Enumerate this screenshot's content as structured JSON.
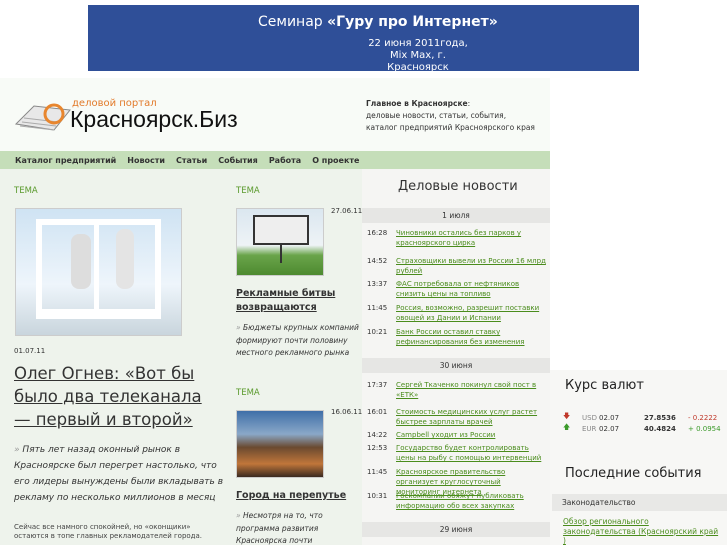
{
  "banner": {
    "line1_pre": "Семинар ",
    "line1_bold": "«Гуру про Интернет»",
    "line2": "22 июня 2011года,",
    "line3": "Mix Max, г. Красноярск"
  },
  "logo": {
    "sub": "деловой портал",
    "main": "Красноярск.Биз"
  },
  "tagline": {
    "bold": "Главное в Красноярске",
    "line1": "деловые новости, статьи, события,",
    "line2": "каталог предприятий Красноярского края"
  },
  "nav": [
    "Каталог предприятий",
    "Новости",
    "Статьи",
    "События",
    "Работа",
    "О проекте"
  ],
  "main_article": {
    "tag": "ТЕМА",
    "date": "01.07.11",
    "title": "Олег Огнев: «Вот бы было два телеканала — первый и второй»",
    "lead": "Пять лет назад оконный рынок в Красноярске был перегрет настолько, что его лидеры вынуждены были вкладывать в рекламу по несколько миллионов в месяц",
    "text": "Сейчас все намного спокойней, но «оконщики» остаются в топе главных рекламодателей города."
  },
  "side_articles": [
    {
      "tag": "ТЕМА",
      "date": "27.06.11",
      "title": "Рекламные битвы возвращаются",
      "lead": "Бюджеты крупных компаний формируют почти половину местного рекламного рынка"
    },
    {
      "tag": "ТЕМА",
      "date": "16.06.11",
      "title": "Город на перепутье",
      "lead": "Несмотря на то, что программа развития Красноярска почти"
    }
  ],
  "news": {
    "title": "Деловые новости",
    "days": [
      {
        "label": "1 июля",
        "items": [
          {
            "time": "16:28",
            "text": "Чиновники остались без парков у красноярского цирка"
          },
          {
            "time": "14:52",
            "text": "Страховщики вывели из России 16 млрд рублей"
          },
          {
            "time": "13:37",
            "text": "ФАС потребовала от нефтяников снизить цены на топливо"
          },
          {
            "time": "11:45",
            "text": "Россия, возможно, разрешит поставки овощей из Дании и Испании"
          },
          {
            "time": "10:21",
            "text": "Банк России оставил ставку рефинансирования без изменения"
          }
        ]
      },
      {
        "label": "30 июня",
        "items": [
          {
            "time": "17:37",
            "text": "Сергей Ткаченко покинул свой пост в «ЕТК»"
          },
          {
            "time": "16:01",
            "text": "Стоимость медицинских услуг растет быстрее зарплаты врачей"
          },
          {
            "time": "14:22",
            "text": "Campbell уходит из России"
          },
          {
            "time": "12:53",
            "text": "Государство будет контролировать цены на рыбу с помощью интервенций"
          },
          {
            "time": "11:45",
            "text": "Красноярское правительство организует круглосуточный мониторинг интернета"
          },
          {
            "time": "10:31",
            "text": "Госкомпании обяжут публиковать информацию обо всех закупках"
          }
        ]
      },
      {
        "label": "29 июня",
        "items": []
      }
    ]
  },
  "rates": {
    "title": "Курс валют",
    "rows": [
      {
        "cur": "USD",
        "date": "02.07",
        "value": "27.8536",
        "change": "- 0.2222",
        "dir": "down"
      },
      {
        "cur": "EUR",
        "date": "02.07",
        "value": "40.4824",
        "change": "+ 0.0954",
        "dir": "up"
      }
    ]
  },
  "events": {
    "title": "Последние события",
    "category": "Законодательство",
    "item": "Обзор регионального законодательства (Красноярский край )"
  }
}
